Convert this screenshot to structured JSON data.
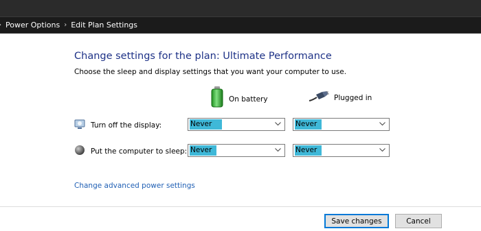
{
  "breadcrumb": {
    "lead_separator": "›",
    "items": [
      "Power Options",
      "Edit Plan Settings"
    ],
    "separator": "›"
  },
  "main": {
    "title": "Change settings for the plan: Ultimate Performance",
    "subtitle": "Choose the sleep and display settings that you want your computer to use.",
    "columns": {
      "battery": {
        "label": "On battery",
        "icon": "battery-icon"
      },
      "plugged": {
        "label": "Plugged in",
        "icon": "power-plug-icon"
      }
    },
    "rows": [
      {
        "label": "Turn off the display:",
        "icon": "monitor-icon",
        "battery_value": "Never",
        "plugged_value": "Never"
      },
      {
        "label": "Put the computer to sleep:",
        "icon": "sleep-moon-icon",
        "battery_value": "Never",
        "plugged_value": "Never"
      }
    ],
    "advanced_link": "Change advanced power settings"
  },
  "footer": {
    "save_label": "Save changes",
    "cancel_label": "Cancel"
  },
  "colors": {
    "title": "#1e3287",
    "link": "#1f5fb4",
    "selection": "#3fb8d8",
    "address_bar": "#1b1b1b"
  }
}
